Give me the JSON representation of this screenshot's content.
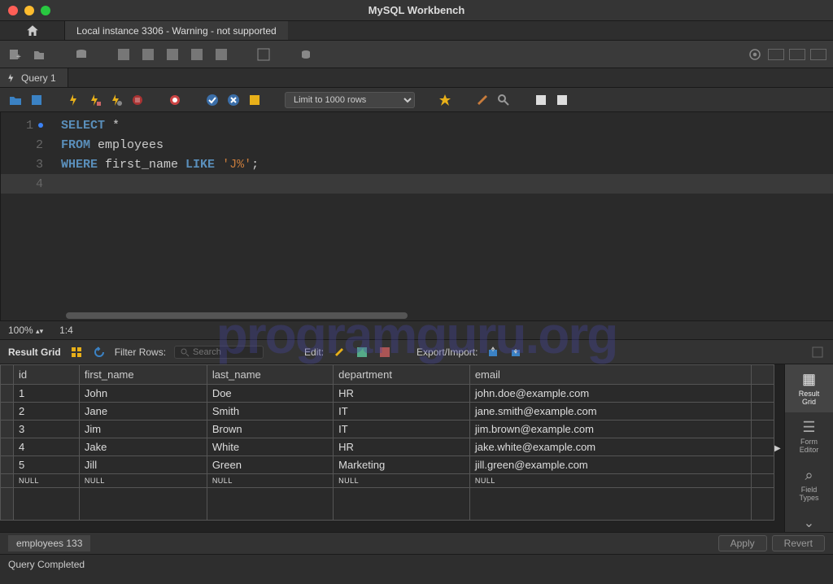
{
  "app_title": "MySQL Workbench",
  "connection_tab": "Local instance 3306 - Warning - not supported",
  "query_tab": "Query 1",
  "limit_selected": "Limit to 1000 rows",
  "sql": {
    "lines": [
      {
        "n": "1",
        "kw1": "SELECT",
        "rest": " *"
      },
      {
        "n": "2",
        "kw1": "FROM",
        "rest": " employees"
      },
      {
        "n": "3",
        "kw1": "WHERE",
        "rest_a": " first_name ",
        "kw2": "LIKE",
        "str": " 'J%'",
        "term": ";"
      },
      {
        "n": "4"
      }
    ]
  },
  "zoom": "100%",
  "cursor_pos": "1:4",
  "result_grid_label": "Result Grid",
  "filter_label": "Filter Rows:",
  "filter_placeholder": "Search",
  "edit_label": "Edit:",
  "export_label": "Export/Import:",
  "columns": [
    "id",
    "first_name",
    "last_name",
    "department",
    "email"
  ],
  "rows": [
    [
      "1",
      "John",
      "Doe",
      "HR",
      "john.doe@example.com"
    ],
    [
      "2",
      "Jane",
      "Smith",
      "IT",
      "jane.smith@example.com"
    ],
    [
      "3",
      "Jim",
      "Brown",
      "IT",
      "jim.brown@example.com"
    ],
    [
      "4",
      "Jake",
      "White",
      "HR",
      "jake.white@example.com"
    ],
    [
      "5",
      "Jill",
      "Green",
      "Marketing",
      "jill.green@example.com"
    ]
  ],
  "null_marker": "NULL",
  "side_panels": {
    "result_grid": "Result\nGrid",
    "form_editor": "Form\nEditor",
    "field_types": "Field\nTypes"
  },
  "footer_tab": "employees 133",
  "apply_btn": "Apply",
  "revert_btn": "Revert",
  "status": "Query Completed",
  "watermark": "programguru.org"
}
